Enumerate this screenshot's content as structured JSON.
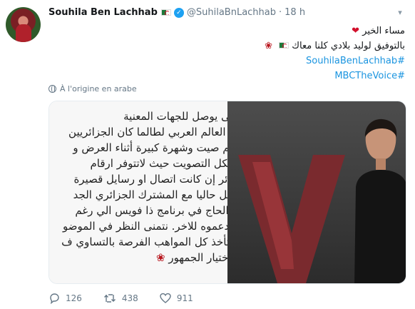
{
  "tweet": {
    "author_name": "Souhila Ben Lachhab",
    "handle": "@SuhilaBnLachhab",
    "separator": "·",
    "time": "18 h",
    "text_lines": [
      "مساء الخير",
      "بالتوفيق لوليد بلادي كلنا معاك",
      "#SouhilaBenLachhab",
      "#MBCTheVoice"
    ],
    "translate_label": "À l'origine en arabe"
  },
  "media": {
    "text_lines": [
      "...نى يوصل للجهات المعنية",
      "في العالم العربي لطالما كان الجزائريين",
      "ولهم صيت وشهرة كبيرة أثناء العرض و",
      "مشكل التصويت حيث لاتتوفر ارقام",
      "جزائر إن كانت اتصال او رسايل قصيرة",
      "حصل حاليا مع المشترك الجزائري الجد",
      "بن الحاج في برنامج ذا فويس الي رغم",
      "ح ندعموه للاخر. نتمنى النظر في الموضو",
      "م لتأخذ كل المواهب الفرصة بالتساوي ف",
      "ر باختيار الجمهور"
    ]
  },
  "actions": {
    "replies": "126",
    "retweets": "438",
    "likes": "911"
  },
  "colors": {
    "link": "#1b95e0",
    "verified": "#1da1f2",
    "muted": "#657786",
    "heart": "#d2102c"
  },
  "icons": [
    "avatar",
    "algeria-flag-icon",
    "verified-icon",
    "chevron-down-icon",
    "heart-emoji-icon",
    "rose-emoji-icon",
    "globe-icon",
    "reply-icon",
    "retweet-icon",
    "like-icon"
  ]
}
